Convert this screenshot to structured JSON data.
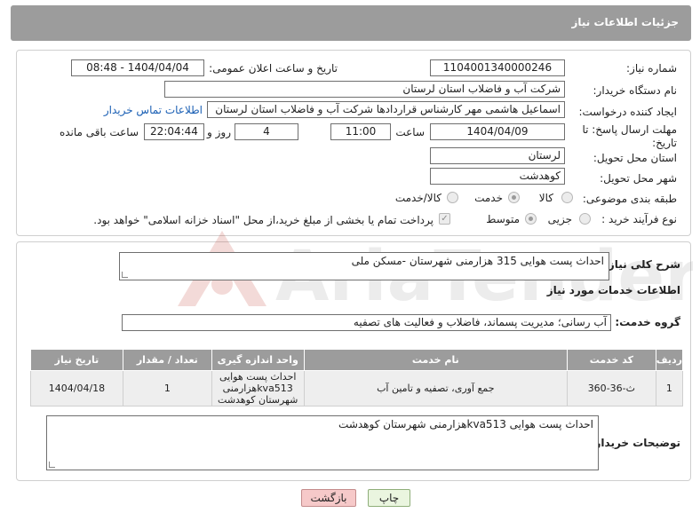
{
  "header": {
    "title": "جزئیات اطلاعات نیاز"
  },
  "form": {
    "need_number_label": "شماره نیاز:",
    "need_number": "1104001340000246",
    "announce_label": "تاریخ و ساعت اعلان عمومی:",
    "announce_value": "1404/04/04 - 08:48",
    "buyer_org_label": "نام دستگاه خریدار:",
    "buyer_org": "شرکت آب و فاضلاب استان لرستان",
    "creator_label": "ایجاد کننده درخواست:",
    "creator": "اسماعیل هاشمی مهر کارشناس قراردادها شرکت آب و فاضلاب استان لرستان",
    "contact_link": "اطلاعات تماس خریدار",
    "deadline_label": "مهلت ارسال پاسخ: تا تاریخ:",
    "deadline_date": "1404/04/09",
    "time_label": "ساعت",
    "deadline_time": "11:00",
    "days_value": "4",
    "days_label": "روز و",
    "remaining_time": "22:04:44",
    "remaining_label": "ساعت باقی مانده",
    "province_label": "استان محل تحویل:",
    "province": "لرستان",
    "city_label": "شهر محل تحویل:",
    "city": "کوهدشت",
    "category_label": "طبقه بندی موضوعی:",
    "category_options": [
      "کالا",
      "خدمت",
      "کالا/خدمت"
    ],
    "category_selected": "خدمت",
    "process_label": "نوع فرآیند خرید :",
    "process_options": [
      "جزیی",
      "متوسط"
    ],
    "process_selected": "متوسط",
    "payment_note": "پرداخت تمام یا بخشی از مبلغ خرید،از محل \"اسناد خزانه اسلامی\" خواهد بود."
  },
  "details": {
    "summary_label": "شرح کلی نیاز:",
    "summary": "احداث پست هوایی 315 هزارمنی شهرستان -مسکن ملی",
    "services_heading": "اطلاعات خدمات مورد نیاز",
    "service_group_label": "گروه خدمت:",
    "service_group": "آب رسانی؛ مدیریت پسماند، فاضلاب و فعالیت های تصفیه"
  },
  "table": {
    "headers": [
      "ردیف",
      "کد خدمت",
      "نام خدمت",
      "واحد اندازه گیری",
      "تعداد / مقدار",
      "تاریخ نیاز"
    ],
    "rows": [
      [
        "1",
        "ث-36-360",
        "جمع آوری، تصفیه و تامین آب",
        "احداث پست هوایی kva513هزارمنی شهرستان کوهدشت",
        "1",
        "1404/04/18"
      ]
    ]
  },
  "buyer_notes": {
    "label": "توضیحات خریدار:",
    "text": "احداث پست هوایی  kva513هزارمنی شهرستان کوهدشت"
  },
  "buttons": {
    "back": "بازگشت",
    "print": "چاپ"
  },
  "watermark": {
    "text": "AriaTender.neT"
  },
  "colors": {
    "header_bg": "#9c9c9c",
    "link": "#1a5fb4",
    "back_btn": "#f6c9c9",
    "print_btn": "#eaf5df"
  }
}
